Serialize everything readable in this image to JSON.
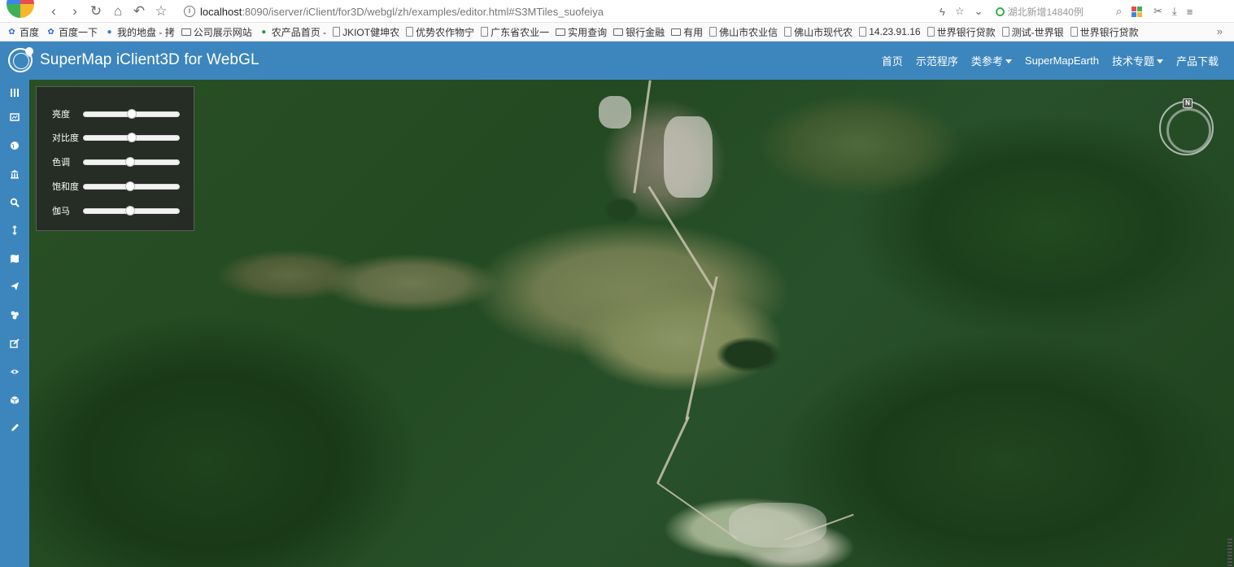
{
  "browser": {
    "url_host": "localhost",
    "url_rest": ":8090/iserver/iClient/for3D/webgl/zh/examples/editor.html#S3MTiles_suofeiya",
    "news_text": "湖北新增14840例",
    "logo_colors": [
      "#e94c4c",
      "#f6b72d",
      "#3fb05a",
      "#3b86e8"
    ]
  },
  "bookmarks": [
    {
      "label": "百度",
      "icon": "baidu-icon"
    },
    {
      "label": "百度一下",
      "icon": "paw-icon"
    },
    {
      "label": "我的地盘 - 拷",
      "icon": "globe-icon"
    },
    {
      "label": "公司展示网站",
      "icon": "folder-icon"
    },
    {
      "label": "农产品首页 -",
      "icon": "leaf-icon"
    },
    {
      "label": "JKIOT健坤农",
      "icon": "page-icon"
    },
    {
      "label": "优势农作物宁",
      "icon": "page-icon"
    },
    {
      "label": "广东省农业一",
      "icon": "page-icon"
    },
    {
      "label": "实用查询",
      "icon": "folder-icon"
    },
    {
      "label": "银行金融",
      "icon": "folder-icon"
    },
    {
      "label": "有用",
      "icon": "folder-icon"
    },
    {
      "label": "佛山市农业信",
      "icon": "page-icon"
    },
    {
      "label": "佛山市现代农",
      "icon": "page-icon"
    },
    {
      "label": "14.23.91.16",
      "icon": "page-icon"
    },
    {
      "label": "世界银行贷款",
      "icon": "page-icon"
    },
    {
      "label": "测试-世界银",
      "icon": "page-icon"
    },
    {
      "label": "世界银行贷款",
      "icon": "page-icon"
    }
  ],
  "bookmarks_more": "»",
  "app": {
    "title": "SuperMap iClient3D for WebGL",
    "header_color": "#3d86bd",
    "nav": [
      {
        "label": "首页",
        "dropdown": false
      },
      {
        "label": "示范程序",
        "dropdown": false
      },
      {
        "label": "类参考",
        "dropdown": true
      },
      {
        "label": "SuperMapEarth",
        "dropdown": false
      },
      {
        "label": "技术专题",
        "dropdown": true
      },
      {
        "label": "产品下载",
        "dropdown": false
      }
    ]
  },
  "sidebar_icons": [
    "layers-icon",
    "scene-icon",
    "globe-icon",
    "bank-icon",
    "search-icon",
    "measure-icon",
    "map-icon",
    "fly-icon",
    "cluster-icon",
    "edit-icon",
    "view-icon",
    "model-icon",
    "pen-icon"
  ],
  "adjust_panel": {
    "sliders": [
      {
        "label": "亮度",
        "value": 0.5
      },
      {
        "label": "对比度",
        "value": 0.5
      },
      {
        "label": "色调",
        "value": 0.49
      },
      {
        "label": "饱和度",
        "value": 0.49
      },
      {
        "label": "伽马",
        "value": 0.49
      }
    ]
  },
  "compass": {
    "north_label": "N"
  }
}
